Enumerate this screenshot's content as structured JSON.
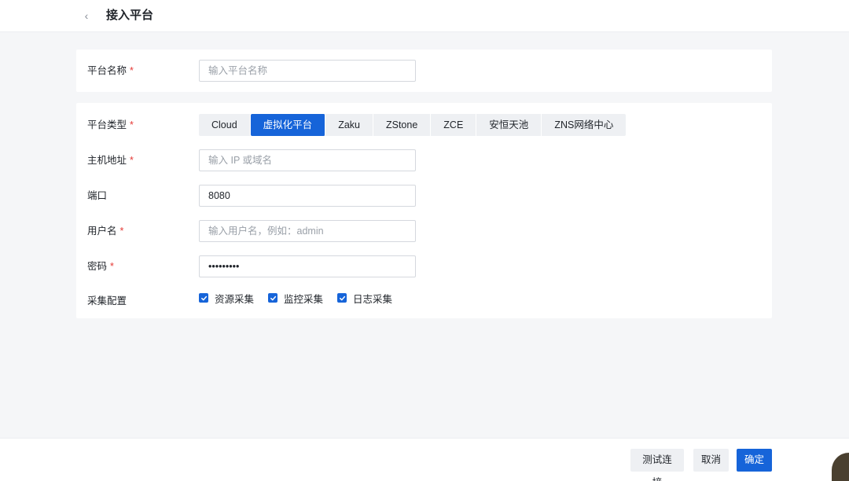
{
  "header": {
    "back_icon": "chevron-left-icon",
    "back_glyph": "‹",
    "title": "接入平台"
  },
  "form": {
    "required_mark": "*",
    "platform_name": {
      "label": "平台名称",
      "value": "",
      "placeholder": "输入平台名称"
    },
    "platform_type": {
      "label": "平台类型",
      "options": [
        "Cloud",
        "虚拟化平台",
        "Zaku",
        "ZStone",
        "ZCE",
        "安恒天池",
        "ZNS网络中心"
      ],
      "selected": "虚拟化平台"
    },
    "host": {
      "label": "主机地址",
      "value": "",
      "placeholder": "输入 IP 或域名"
    },
    "port": {
      "label": "端口",
      "value": "8080",
      "placeholder": ""
    },
    "username": {
      "label": "用户名",
      "value": "",
      "placeholder": "输入用户名，例如：admin"
    },
    "password": {
      "label": "密码",
      "value": "123456789",
      "placeholder": ""
    },
    "collection": {
      "label": "采集配置",
      "items": [
        {
          "label": "资源采集",
          "checked": true
        },
        {
          "label": "监控采集",
          "checked": true
        },
        {
          "label": "日志采集",
          "checked": true
        }
      ]
    }
  },
  "footer": {
    "test_label": "测试连接",
    "cancel_label": "取消",
    "confirm_label": "确定"
  },
  "colors": {
    "accent": "#1664d9",
    "required": "#e53935",
    "page_bg": "#f5f6f8"
  }
}
